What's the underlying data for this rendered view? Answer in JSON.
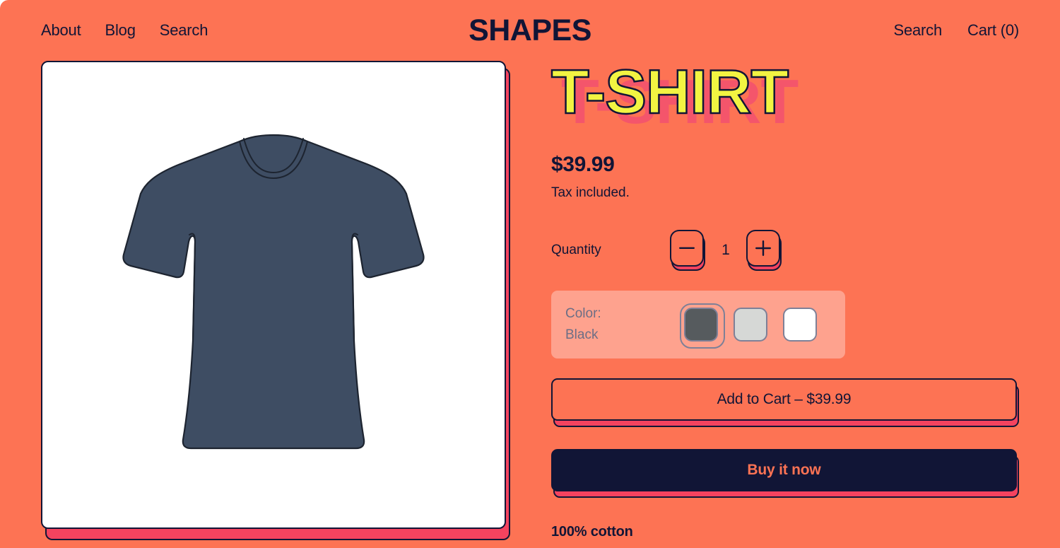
{
  "theme": {
    "background": "#FD7354",
    "ink": "#111536",
    "shadow_pink": "#F4435F",
    "title_yellow": "#F2F442",
    "title_shadow": "#F4556B",
    "muted": "#6C6E85"
  },
  "header": {
    "logo": "SHAPES",
    "nav_left": [
      {
        "label": "About"
      },
      {
        "label": "Blog"
      },
      {
        "label": "Search"
      }
    ],
    "nav_right": [
      {
        "label": "Search"
      },
      {
        "label": "Cart (0)"
      }
    ]
  },
  "media": {
    "alt": "t-shirt-illustration",
    "shirt_color": "#3E4D63"
  },
  "product": {
    "title": "T-SHIRT",
    "price": "$39.99",
    "tax_note": "Tax included.",
    "quantity": {
      "label": "Quantity",
      "value": "1",
      "decrease_icon": "minus-icon",
      "increase_icon": "plus-icon"
    },
    "color_option": {
      "label": "Color:",
      "value": "Black",
      "swatches": [
        {
          "name": "Black",
          "hex": "#565B5E",
          "selected": true
        },
        {
          "name": "Grey",
          "hex": "#D6D8D6",
          "selected": false
        },
        {
          "name": "White",
          "hex": "#FFFFFF",
          "selected": false
        }
      ]
    },
    "add_to_cart_label": "Add to Cart – $39.99",
    "buy_now_label": "Buy it now",
    "description": "100% cotton"
  }
}
